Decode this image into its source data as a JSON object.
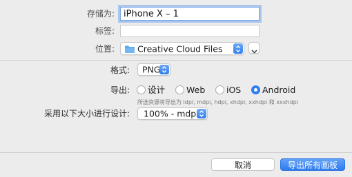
{
  "form": {
    "save_as_label": "存储为:",
    "save_as_value": "iPhone X – 1",
    "tags_label": "标签:",
    "tags_value": "",
    "location_label": "位置:",
    "location_value": "Creative Cloud Files"
  },
  "export": {
    "format_label": "格式:",
    "format_value": "PNG",
    "export_for_label": "导出:",
    "options": [
      {
        "label": "设计",
        "selected": false
      },
      {
        "label": "Web",
        "selected": false
      },
      {
        "label": "iOS",
        "selected": false
      },
      {
        "label": "Android",
        "selected": true
      }
    ],
    "hint": "所选资源将导出为 ldpi, mdpi, hdpi, xhdpi, xxhdpi 和 xxxhdpi",
    "design_size_label": "采用以下大小进行设计:",
    "design_size_value": "100% - mdpi"
  },
  "footer": {
    "cancel_label": "取消",
    "export_all_label": "导出所有画板"
  },
  "colors": {
    "accent": "#2f7ef0",
    "folder": "#5aa7e8"
  }
}
